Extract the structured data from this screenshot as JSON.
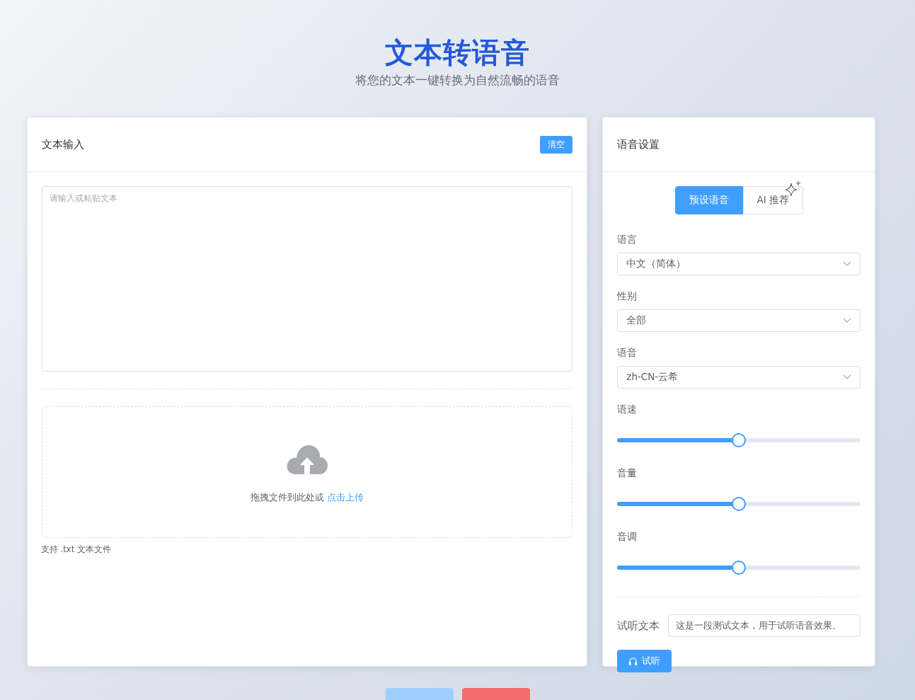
{
  "header": {
    "title": "文本转语音",
    "subtitle": "将您的文本一键转换为自然流畅的语音"
  },
  "text_panel": {
    "title": "文本输入",
    "clear_button": "清空",
    "textarea": {
      "placeholder": "请输入或粘贴文本"
    },
    "upload": {
      "prompt": "拖拽文件到此处或",
      "link": "点击上传"
    },
    "hint": "支持 .txt 文本文件"
  },
  "voice_panel": {
    "title": "语音设置",
    "tabs": [
      {
        "label": "预设语音",
        "selected": true,
        "sparkle": false
      },
      {
        "label": "AI 推荐",
        "selected": false,
        "sparkle": true
      }
    ],
    "selects": [
      {
        "label": "语言",
        "value": "中文（简体）"
      },
      {
        "label": "性别",
        "value": "全部"
      },
      {
        "label": "语音",
        "value": "zh-CN-云希"
      }
    ],
    "sliders": [
      {
        "label": "语速",
        "level": 0.5
      },
      {
        "label": "音量",
        "level": 0.5
      },
      {
        "label": "音调",
        "level": 0.5
      }
    ],
    "preview": {
      "label": "试听文本",
      "value": "这是一段测试文本，用于试听语音效果。",
      "button": "试听"
    }
  },
  "actions": [
    {
      "kind": "primary",
      "disabled": true
    },
    {
      "kind": "danger",
      "disabled": false
    }
  ]
}
